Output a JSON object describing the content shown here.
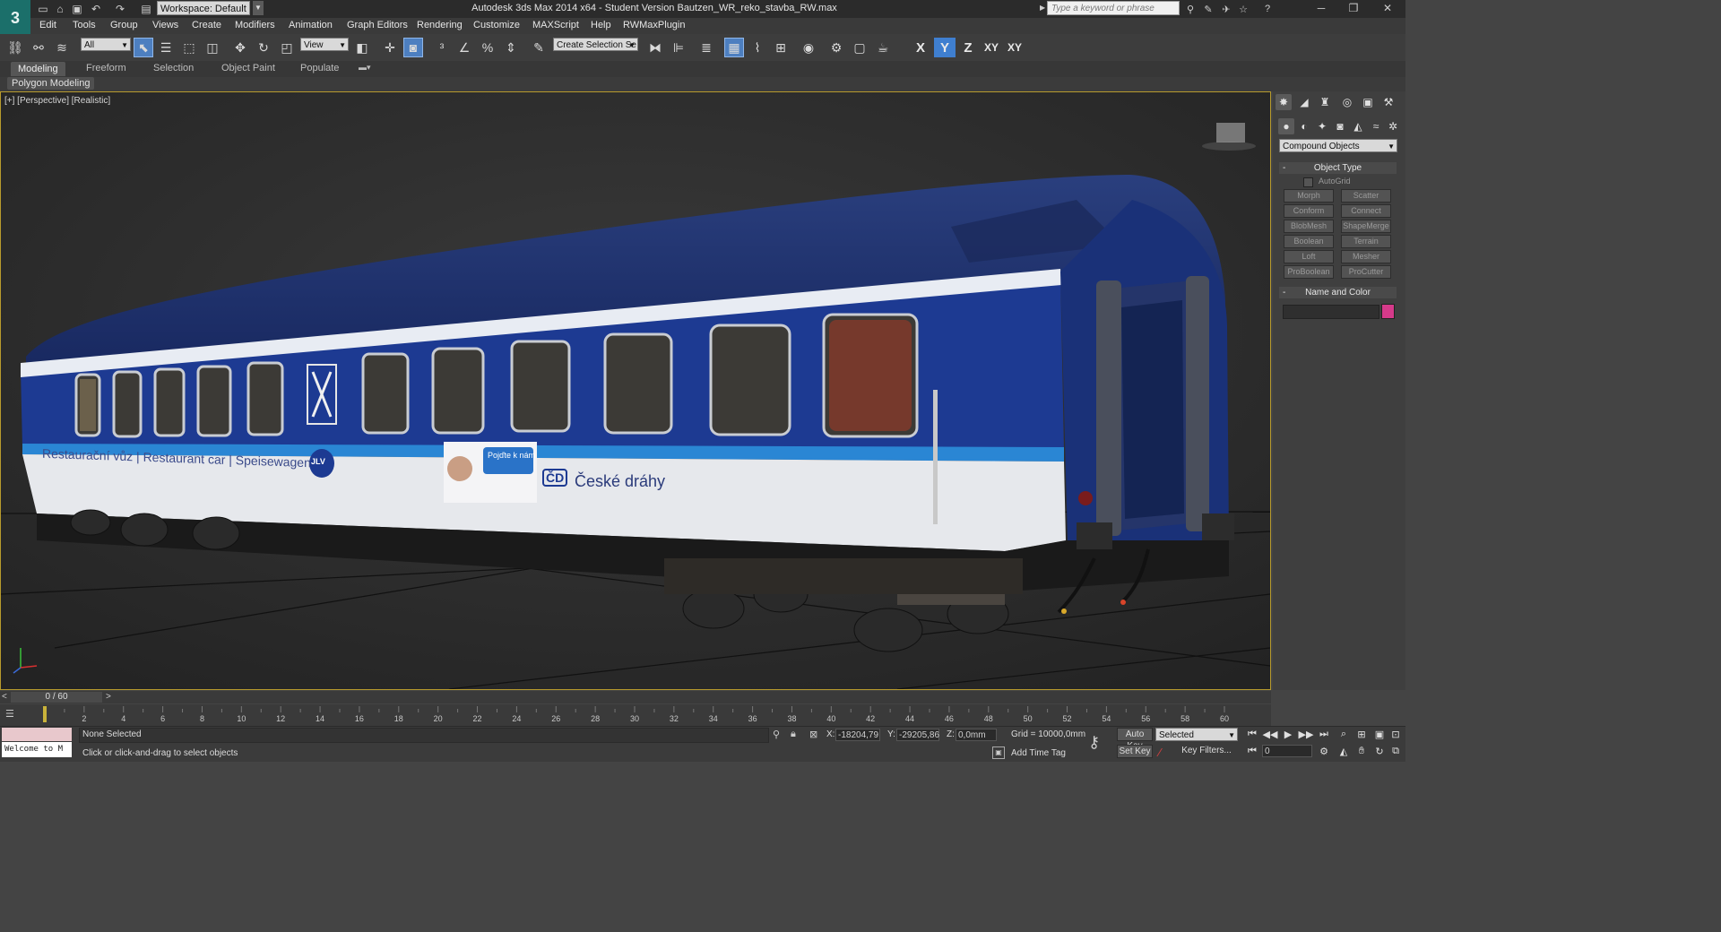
{
  "window": {
    "title": "Autodesk 3ds Max  2014 x64  - Student Version   Bautzen_WR_reko_stavba_RW.max",
    "workspace": "Workspace: Default",
    "search_placeholder": "Type a keyword or phrase",
    "logo": "3"
  },
  "menu": [
    "Edit",
    "Tools",
    "Group",
    "Views",
    "Create",
    "Modifiers",
    "Animation",
    "Graph Editors",
    "Rendering",
    "Customize",
    "MAXScript",
    "Help",
    "RWMaxPlugin"
  ],
  "toolbar": {
    "selection_filter": "All",
    "ref_coord": "View",
    "named_selection": "Create Selection Se",
    "axis_x": "X",
    "axis_y": "Y",
    "axis_z": "Z",
    "axis_xy": "XY",
    "axis_xy2": "XY"
  },
  "ribbon": {
    "tabs": [
      "Modeling",
      "Freeform",
      "Selection",
      "Object Paint",
      "Populate"
    ],
    "panel": "Polygon Modeling"
  },
  "viewport": {
    "label": "[+] [Perspective] [Realistic]",
    "car_texts": {
      "side_title": "Restaurační vůz | Restaurant car | Speisewagen",
      "operator": "České dráhy",
      "ad_text": "Pojďte k nám",
      "logo_badge": "JLV",
      "cd_logo": "ČD"
    }
  },
  "command_panel": {
    "category": "Compound Objects",
    "object_type_title": "Object Type",
    "autogrid": "AutoGrid",
    "buttons": [
      "Morph",
      "Scatter",
      "Conform",
      "Connect",
      "BlobMesh",
      "ShapeMerge",
      "Boolean",
      "Terrain",
      "Loft",
      "Mesher",
      "ProBoolean",
      "ProCutter"
    ],
    "name_color_title": "Name and Color",
    "swatch_color": "#d53a8a"
  },
  "timeline": {
    "position": "0 / 60",
    "ticks": [
      "2",
      "4",
      "6",
      "8",
      "10",
      "12",
      "14",
      "16",
      "18",
      "20",
      "22",
      "24",
      "26",
      "28",
      "30",
      "32",
      "34",
      "36",
      "38",
      "40",
      "42",
      "44",
      "46",
      "48",
      "50",
      "52",
      "54",
      "56",
      "58",
      "60"
    ]
  },
  "status": {
    "welcome": "Welcome to M",
    "selection": "None Selected",
    "prompt": "Click or click-and-drag to select objects",
    "x_label": "X:",
    "x_value": "-18204,79",
    "y_label": "Y:",
    "y_value": "-29205,86",
    "z_label": "Z:",
    "z_value": "0,0mm",
    "grid": "Grid = 10000,0mm",
    "add_time_tag": "Add Time Tag",
    "auto_key": "Auto Key",
    "set_key": "Set Key",
    "key_mode": "Selected",
    "key_filters": "Key Filters...",
    "frame": "0"
  }
}
